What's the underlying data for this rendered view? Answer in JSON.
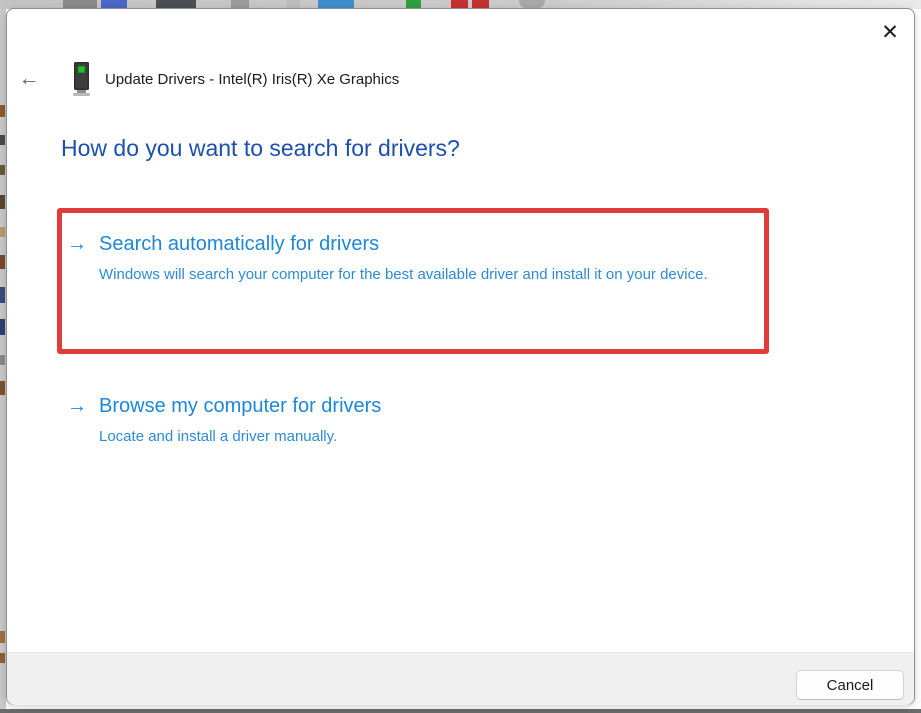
{
  "window": {
    "title": "Update Drivers - Intel(R) Iris(R) Xe Graphics",
    "heading": "How do you want to search for drivers?"
  },
  "options": [
    {
      "title": "Search automatically for drivers",
      "description": "Windows will search your computer for the best available driver and install it on your device.",
      "highlighted": true
    },
    {
      "title": "Browse my computer for drivers",
      "description": "Locate and install a driver manually.",
      "highlighted": false
    }
  ],
  "footer": {
    "cancel_label": "Cancel"
  },
  "icons": {
    "back": "←",
    "close": "✕",
    "arrow": "→",
    "display_adapter": "display-adapter-device-icon"
  },
  "colors": {
    "heading_blue": "#1c4fae",
    "option_blue": "#1e87d8",
    "description_blue": "#2e8ad6",
    "highlight_red": "#e23b3b",
    "footer_gray": "#f0f0f0",
    "device_led_green": "#25c02b"
  }
}
